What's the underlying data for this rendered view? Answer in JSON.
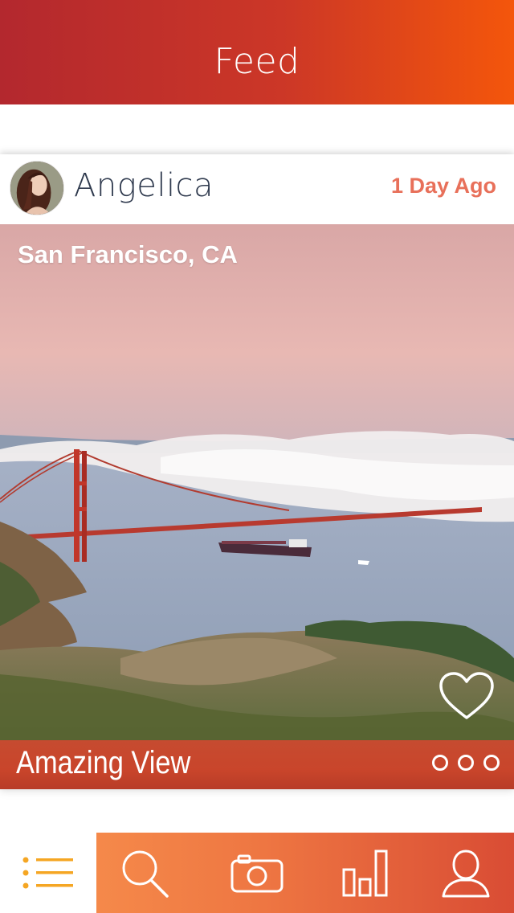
{
  "header": {
    "title": "Feed"
  },
  "post": {
    "user": {
      "name": "Angelica"
    },
    "timestamp": "1 Day Ago",
    "location": "San Francisco, CA",
    "caption": "Amazing View",
    "icons": {
      "like": "heart-icon",
      "more": "more-dots-icon"
    }
  },
  "tabbar": {
    "items": [
      {
        "name": "feed",
        "icon": "list-icon",
        "active": true
      },
      {
        "name": "search",
        "icon": "search-icon"
      },
      {
        "name": "camera",
        "icon": "camera-icon"
      },
      {
        "name": "stats",
        "icon": "bar-chart-icon"
      },
      {
        "name": "profile",
        "icon": "user-icon"
      }
    ]
  },
  "colors": {
    "header_gradient_start": "#b3282e",
    "header_gradient_end": "#f4560b",
    "timestamp": "#e8705a",
    "username": "#2f3a4e",
    "caption_bar": "#c64b30",
    "tabbar_gradient_start": "#f5894a",
    "tabbar_gradient_end": "#d94c34",
    "active_tab_icon": "#f5a623"
  }
}
